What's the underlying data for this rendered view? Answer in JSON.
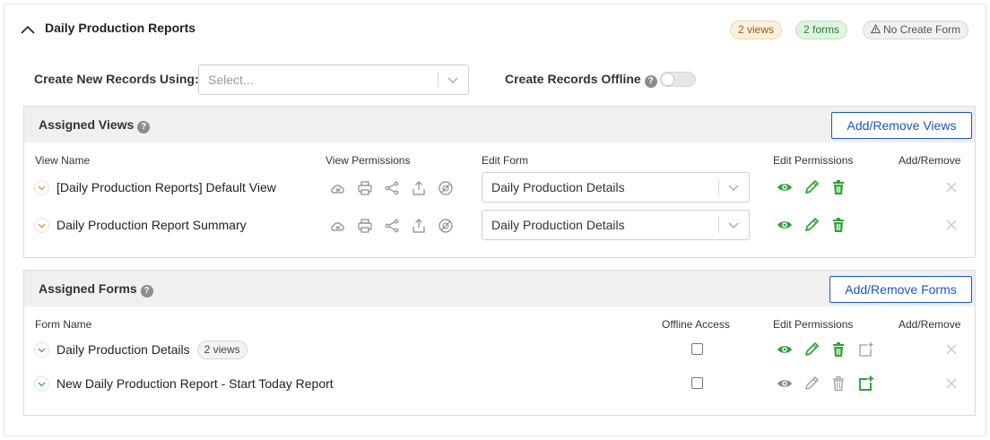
{
  "header": {
    "title": "Daily Production Reports",
    "views_badge": "2 views",
    "forms_badge": "2 forms",
    "no_create_badge": "No Create Form"
  },
  "create_new": {
    "label": "Create New Records Using:",
    "placeholder": "Select..."
  },
  "create_offline": {
    "label": "Create Records Offline",
    "enabled": false
  },
  "assigned_views": {
    "title": "Assigned Views",
    "button_label": "Add/Remove Views",
    "columns": {
      "name": "View Name",
      "view_permissions": "View Permissions",
      "edit_form": "Edit Form",
      "edit_permissions": "Edit Permissions",
      "add_remove": "Add/Remove"
    },
    "rows": [
      {
        "name": "[Daily Production Reports] Default View",
        "edit_form": "Daily Production Details"
      },
      {
        "name": "Daily Production Report Summary",
        "edit_form": "Daily Production Details"
      }
    ]
  },
  "assigned_forms": {
    "title": "Assigned Forms",
    "button_label": "Add/Remove Forms",
    "columns": {
      "name": "Form Name",
      "offline_access": "Offline Access",
      "edit_permissions": "Edit Permissions",
      "add_remove": "Add/Remove"
    },
    "rows": [
      {
        "name": "Daily Production Details",
        "badge": "2 views",
        "offline": false,
        "permissions_active": true,
        "create_active": false
      },
      {
        "name": "New Daily Production Report - Start Today Report",
        "badge": "",
        "offline": false,
        "permissions_active": false,
        "create_active": true
      }
    ]
  },
  "colors": {
    "accent_blue": "#1a56c9",
    "active_green": "#2fa236",
    "inactive_gray": "#8a8a8a",
    "view_chevron": "#e8943a",
    "form_chevron": "#4caf50"
  }
}
